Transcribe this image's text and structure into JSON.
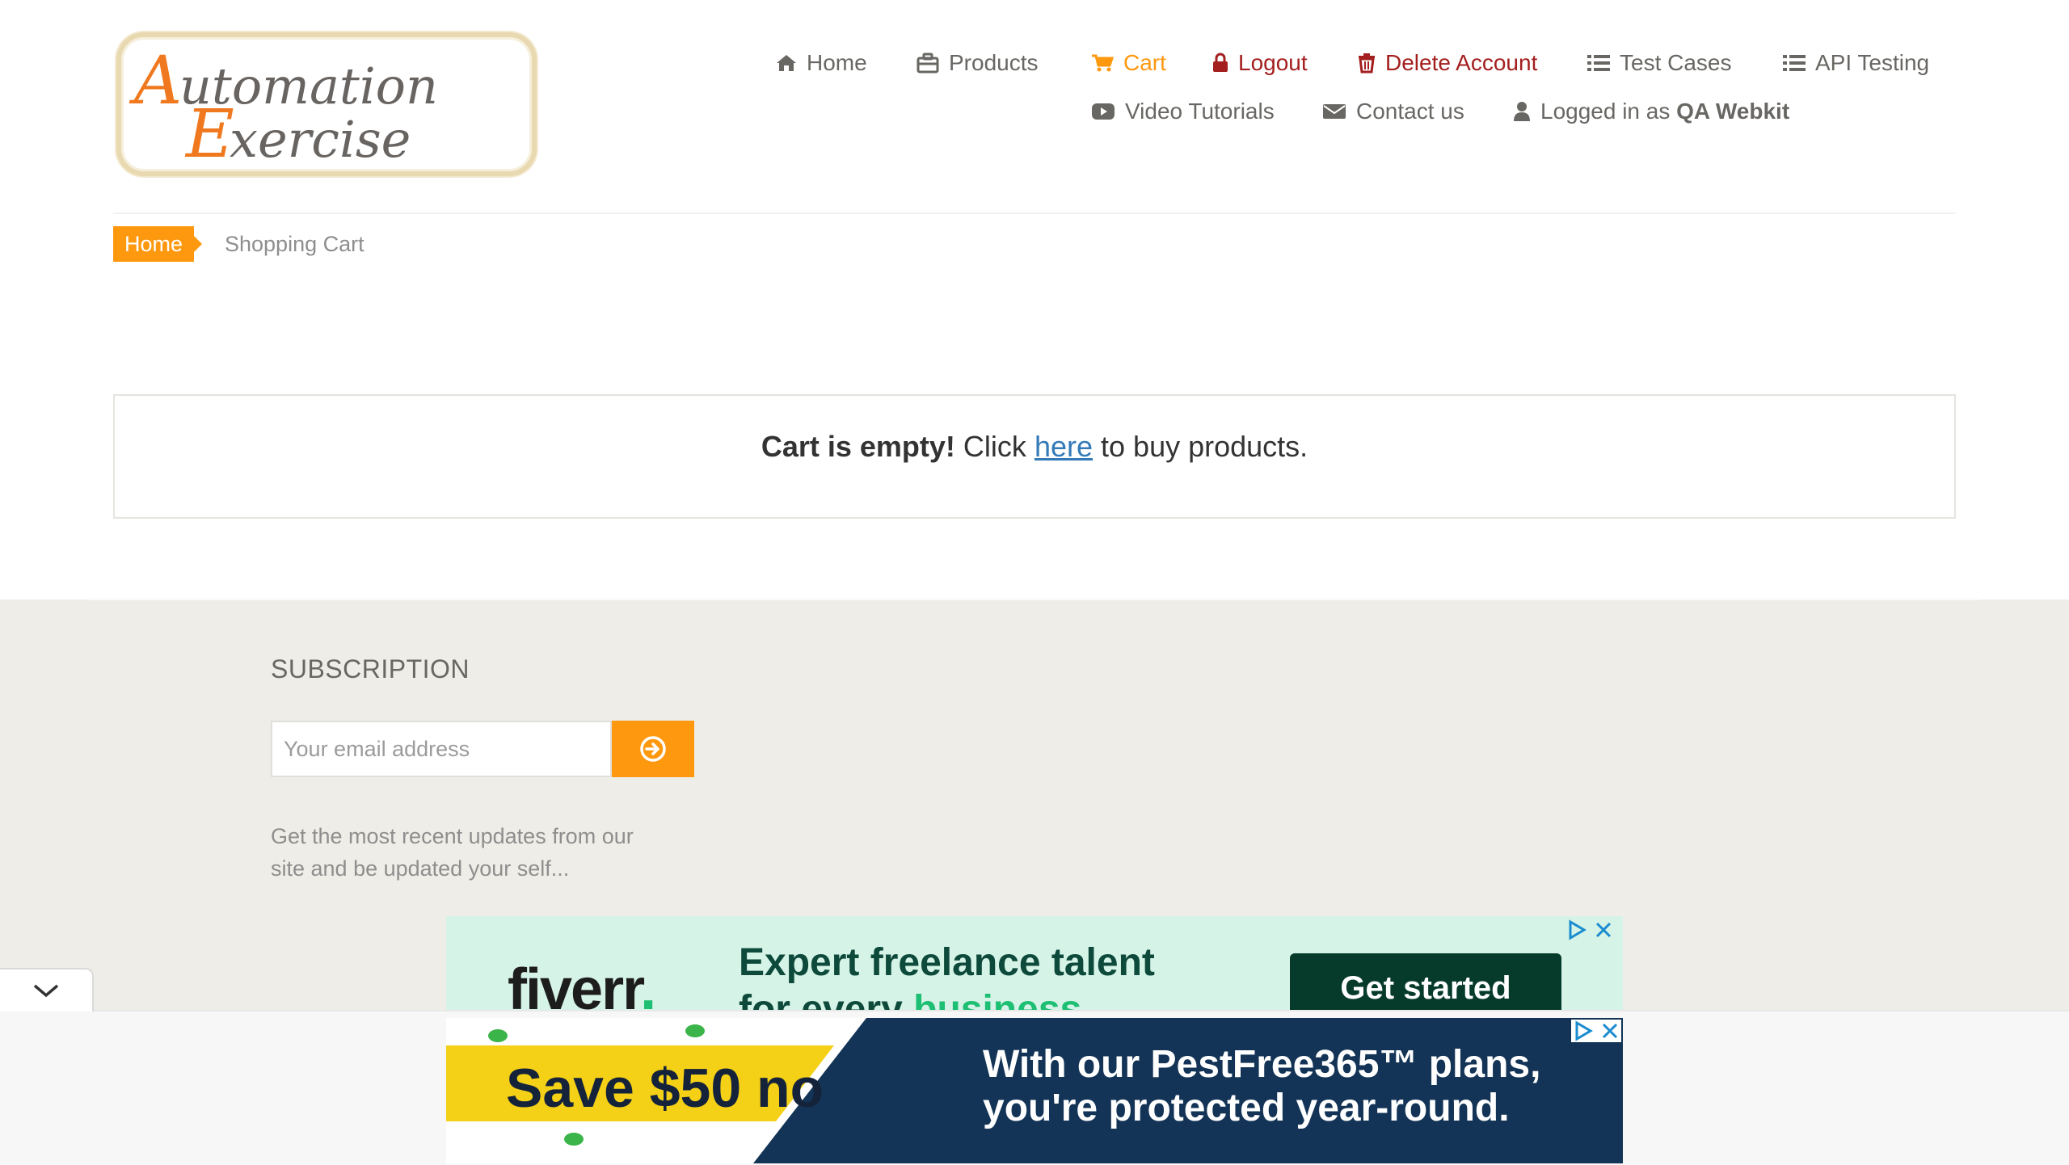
{
  "colors": {
    "accent": "#FE980F",
    "danger": "#a41f1f",
    "link": "#337ab7",
    "footer_bg": "#efede7"
  },
  "header": {
    "logo_line1": "Automation",
    "logo_line2": "Exercise",
    "nav": {
      "home": "Home",
      "products": "Products",
      "cart": "Cart",
      "logout": "Logout",
      "delete_account": "Delete Account",
      "test_cases": "Test Cases",
      "api_testing": "API Testing",
      "video_tutorials": "Video Tutorials",
      "contact_us": "Contact us",
      "logged_in_prefix": "Logged in as",
      "logged_in_user": "QA Webkit"
    }
  },
  "breadcrumb": {
    "home": "Home",
    "current": "Shopping Cart"
  },
  "cart": {
    "empty_bold": "Cart is empty!",
    "click": "Click",
    "link": "here",
    "rest": "to buy products."
  },
  "footer": {
    "subscription_title": "SUBSCRIPTION",
    "email_placeholder": "Your email address",
    "description": "Get the most recent updates from our site and be updated your self..."
  },
  "ads": {
    "fiverr": {
      "brand": "fiverr",
      "brand_dot": ".",
      "headline": "Expert freelance talent",
      "sub_a": "for every",
      "sub_b": "business",
      "cta": "Get started"
    },
    "pest": {
      "save": "Save $50 no",
      "line1": "With our PestFree365™ plans,",
      "line2": "you're protected year-round."
    }
  }
}
